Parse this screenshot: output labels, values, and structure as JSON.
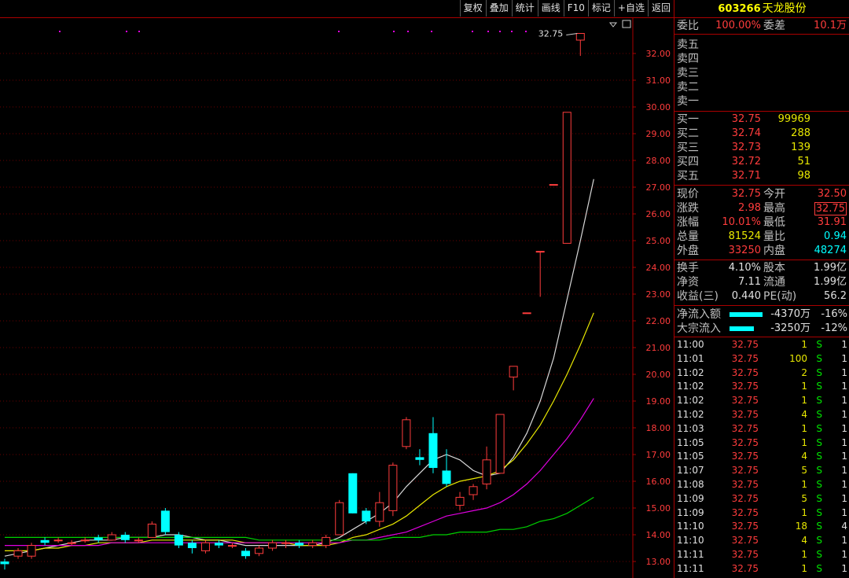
{
  "toolbar": {
    "buttons": [
      "复权",
      "叠加",
      "统计",
      "画线",
      "F10",
      "标记",
      "+自选",
      "返回"
    ]
  },
  "stock": {
    "code": "603266",
    "name": "天龙股份"
  },
  "ratio": {
    "label1": "委比",
    "value1": "100.00%",
    "label2": "委差",
    "value2": "10.1万"
  },
  "asks": [
    {
      "label": "卖五"
    },
    {
      "label": "卖四"
    },
    {
      "label": "卖三"
    },
    {
      "label": "卖二"
    },
    {
      "label": "卖一"
    }
  ],
  "bids": [
    {
      "label": "买一",
      "price": "32.75",
      "vol": "99969"
    },
    {
      "label": "买二",
      "price": "32.74",
      "vol": "288"
    },
    {
      "label": "买三",
      "price": "32.73",
      "vol": "139"
    },
    {
      "label": "买四",
      "price": "32.72",
      "vol": "51"
    },
    {
      "label": "买五",
      "price": "32.71",
      "vol": "98"
    }
  ],
  "quote": [
    {
      "l1": "现价",
      "v1": "32.75",
      "c1": "red",
      "l2": "今开",
      "v2": "32.50",
      "c2": "red"
    },
    {
      "l1": "涨跌",
      "v1": "2.98",
      "c1": "red",
      "l2": "最高",
      "v2": "32.75",
      "c2": "red"
    },
    {
      "l1": "涨幅",
      "v1": "10.01%",
      "c1": "red",
      "l2": "最低",
      "v2": "31.91",
      "c2": "red"
    },
    {
      "l1": "总量",
      "v1": "81524",
      "c1": "yel",
      "l2": "量比",
      "v2": "0.94",
      "c2": "cyan"
    },
    {
      "l1": "外盘",
      "v1": "33250",
      "c1": "red",
      "l2": "内盘",
      "v2": "48274",
      "c2": "cyan"
    }
  ],
  "fundamentals": [
    {
      "l1": "换手",
      "v1": "4.10%",
      "l2": "股本",
      "v2": "1.99亿"
    },
    {
      "l1": "净资",
      "v1": "7.11",
      "l2": "流通",
      "v2": "1.99亿"
    },
    {
      "l1": "收益(三)",
      "v1": "0.440",
      "l2": "PE(动)",
      "v2": "56.2"
    }
  ],
  "flows": [
    {
      "label": "净流入额",
      "value": "-4370万",
      "pct": "-16%",
      "bar": 0.75
    },
    {
      "label": "大宗流入",
      "value": "-3250万",
      "pct": "-12%",
      "bar": 0.56
    }
  ],
  "ticks": [
    {
      "t": "11:00",
      "p": "32.75",
      "v": "1",
      "s": "S",
      "n": "1"
    },
    {
      "t": "11:01",
      "p": "32.75",
      "v": "100",
      "s": "S",
      "n": "1"
    },
    {
      "t": "11:02",
      "p": "32.75",
      "v": "2",
      "s": "S",
      "n": "1"
    },
    {
      "t": "11:02",
      "p": "32.75",
      "v": "1",
      "s": "S",
      "n": "1"
    },
    {
      "t": "11:02",
      "p": "32.75",
      "v": "1",
      "s": "S",
      "n": "1"
    },
    {
      "t": "11:02",
      "p": "32.75",
      "v": "4",
      "s": "S",
      "n": "1"
    },
    {
      "t": "11:03",
      "p": "32.75",
      "v": "1",
      "s": "S",
      "n": "1"
    },
    {
      "t": "11:05",
      "p": "32.75",
      "v": "1",
      "s": "S",
      "n": "1"
    },
    {
      "t": "11:05",
      "p": "32.75",
      "v": "4",
      "s": "S",
      "n": "1"
    },
    {
      "t": "11:07",
      "p": "32.75",
      "v": "5",
      "s": "S",
      "n": "1"
    },
    {
      "t": "11:08",
      "p": "32.75",
      "v": "1",
      "s": "S",
      "n": "1"
    },
    {
      "t": "11:09",
      "p": "32.75",
      "v": "5",
      "s": "S",
      "n": "1"
    },
    {
      "t": "11:09",
      "p": "32.75",
      "v": "1",
      "s": "S",
      "n": "1"
    },
    {
      "t": "11:10",
      "p": "32.75",
      "v": "18",
      "s": "S",
      "n": "4"
    },
    {
      "t": "11:10",
      "p": "32.75",
      "v": "4",
      "s": "S",
      "n": "1"
    },
    {
      "t": "11:11",
      "p": "32.75",
      "v": "1",
      "s": "S",
      "n": "1"
    },
    {
      "t": "11:11",
      "p": "32.75",
      "v": "1",
      "s": "S",
      "n": "1"
    }
  ],
  "chart_data": {
    "type": "candlestick",
    "y_ticks": [
      "32.00",
      "31.00",
      "30.00",
      "29.00",
      "28.00",
      "27.00",
      "26.00",
      "25.00",
      "24.00",
      "23.00",
      "22.00",
      "21.00",
      "20.00",
      "19.00",
      "18.00",
      "17.00",
      "16.00",
      "15.00",
      "14.00",
      "13.00"
    ],
    "ylim": [
      12.7,
      33.0
    ],
    "high_label": "32.75",
    "candles": [
      {
        "o": 13.0,
        "c": 12.9,
        "h": 13.1,
        "l": 12.7
      },
      {
        "o": 13.2,
        "c": 13.4,
        "h": 13.5,
        "l": 13.1
      },
      {
        "o": 13.2,
        "c": 13.6,
        "h": 13.7,
        "l": 13.1
      },
      {
        "o": 13.8,
        "c": 13.7,
        "h": 13.9,
        "l": 13.6
      },
      {
        "o": 13.8,
        "c": 13.8,
        "h": 13.9,
        "l": 13.7
      },
      {
        "o": 13.7,
        "c": 13.7,
        "h": 13.8,
        "l": 13.6
      },
      {
        "o": 13.8,
        "c": 13.8,
        "h": 13.9,
        "l": 13.7
      },
      {
        "o": 13.9,
        "c": 13.8,
        "h": 14.0,
        "l": 13.7
      },
      {
        "o": 13.8,
        "c": 14.0,
        "h": 14.1,
        "l": 13.8
      },
      {
        "o": 14.0,
        "c": 13.8,
        "h": 14.1,
        "l": 13.7
      },
      {
        "o": 13.8,
        "c": 13.8,
        "h": 13.9,
        "l": 13.7
      },
      {
        "o": 13.9,
        "c": 14.4,
        "h": 14.5,
        "l": 13.9
      },
      {
        "o": 14.9,
        "c": 14.1,
        "h": 15.0,
        "l": 14.0
      },
      {
        "o": 14.0,
        "c": 13.6,
        "h": 14.1,
        "l": 13.5
      },
      {
        "o": 13.7,
        "c": 13.5,
        "h": 13.8,
        "l": 13.3
      },
      {
        "o": 13.4,
        "c": 13.7,
        "h": 13.8,
        "l": 13.3
      },
      {
        "o": 13.7,
        "c": 13.6,
        "h": 13.8,
        "l": 13.5
      },
      {
        "o": 13.6,
        "c": 13.6,
        "h": 13.7,
        "l": 13.5
      },
      {
        "o": 13.4,
        "c": 13.2,
        "h": 13.5,
        "l": 13.1
      },
      {
        "o": 13.3,
        "c": 13.5,
        "h": 13.6,
        "l": 13.2
      },
      {
        "o": 13.5,
        "c": 13.7,
        "h": 13.8,
        "l": 13.4
      },
      {
        "o": 13.7,
        "c": 13.7,
        "h": 13.8,
        "l": 13.5
      },
      {
        "o": 13.7,
        "c": 13.6,
        "h": 13.8,
        "l": 13.5
      },
      {
        "o": 13.6,
        "c": 13.7,
        "h": 13.8,
        "l": 13.5
      },
      {
        "o": 13.6,
        "c": 13.9,
        "h": 14.0,
        "l": 13.5
      },
      {
        "o": 14.0,
        "c": 15.2,
        "h": 15.3,
        "l": 14.0
      },
      {
        "o": 16.3,
        "c": 14.8,
        "h": 16.3,
        "l": 14.8
      },
      {
        "o": 14.9,
        "c": 14.5,
        "h": 15.0,
        "l": 14.4
      },
      {
        "o": 14.5,
        "c": 15.2,
        "h": 15.6,
        "l": 14.3
      },
      {
        "o": 14.9,
        "c": 16.6,
        "h": 16.7,
        "l": 14.7
      },
      {
        "o": 17.3,
        "c": 18.3,
        "h": 18.4,
        "l": 17.2
      },
      {
        "o": 16.9,
        "c": 16.8,
        "h": 17.2,
        "l": 16.6
      },
      {
        "o": 17.8,
        "c": 16.5,
        "h": 18.4,
        "l": 16.3
      },
      {
        "o": 16.4,
        "c": 15.9,
        "h": 17.2,
        "l": 15.8
      },
      {
        "o": 15.1,
        "c": 15.4,
        "h": 15.6,
        "l": 14.9
      },
      {
        "o": 15.5,
        "c": 15.8,
        "h": 15.9,
        "l": 15.3
      },
      {
        "o": 15.9,
        "c": 16.8,
        "h": 17.3,
        "l": 15.7
      },
      {
        "o": 16.3,
        "c": 18.5,
        "h": 18.5,
        "l": 16.3
      },
      {
        "o": 19.9,
        "c": 20.3,
        "h": 20.3,
        "l": 19.4
      },
      {
        "o": 22.3,
        "c": 22.3,
        "h": 22.3,
        "l": 22.3
      },
      {
        "o": 24.6,
        "c": 24.6,
        "h": 24.6,
        "l": 22.9
      },
      {
        "o": 27.1,
        "c": 27.1,
        "h": 27.1,
        "l": 27.1
      },
      {
        "o": 24.9,
        "c": 29.8,
        "h": 29.8,
        "l": 24.9
      },
      {
        "o": 32.5,
        "c": 32.75,
        "h": 32.75,
        "l": 31.91
      }
    ],
    "ma_lines": [
      {
        "color": "#d8d8d8",
        "values": [
          13.2,
          13.3,
          13.4,
          13.5,
          13.6,
          13.7,
          13.8,
          13.8,
          13.8,
          13.9,
          13.9,
          13.9,
          14.0,
          14.0,
          13.9,
          13.8,
          13.8,
          13.7,
          13.6,
          13.6,
          13.6,
          13.6,
          13.6,
          13.6,
          13.7,
          13.9,
          14.2,
          14.5,
          14.8,
          15.2,
          15.8,
          16.3,
          16.8,
          17.0,
          16.8,
          16.4,
          16.2,
          16.3,
          16.9,
          17.8,
          19.0,
          20.6,
          22.8,
          25.0,
          27.3
        ]
      },
      {
        "color": "#e8e800",
        "values": [
          13.4,
          13.4,
          13.4,
          13.5,
          13.5,
          13.6,
          13.6,
          13.7,
          13.7,
          13.7,
          13.7,
          13.8,
          13.8,
          13.8,
          13.8,
          13.8,
          13.8,
          13.8,
          13.7,
          13.7,
          13.7,
          13.7,
          13.6,
          13.6,
          13.6,
          13.7,
          13.9,
          14.0,
          14.2,
          14.4,
          14.7,
          15.1,
          15.5,
          15.8,
          16.0,
          16.1,
          16.2,
          16.4,
          16.8,
          17.4,
          18.1,
          19.0,
          20.0,
          21.1,
          22.3
        ]
      },
      {
        "color": "#e000e0",
        "values": [
          13.6,
          13.6,
          13.6,
          13.6,
          13.6,
          13.6,
          13.6,
          13.6,
          13.7,
          13.7,
          13.7,
          13.7,
          13.7,
          13.7,
          13.7,
          13.7,
          13.7,
          13.7,
          13.7,
          13.7,
          13.7,
          13.7,
          13.7,
          13.7,
          13.7,
          13.7,
          13.8,
          13.8,
          13.9,
          14.0,
          14.1,
          14.3,
          14.5,
          14.7,
          14.8,
          14.9,
          15.0,
          15.2,
          15.5,
          15.9,
          16.4,
          17.0,
          17.6,
          18.3,
          19.1
        ]
      },
      {
        "color": "#00d000",
        "values": [
          13.9,
          13.9,
          13.9,
          13.9,
          13.9,
          13.9,
          13.9,
          13.9,
          13.9,
          13.9,
          13.9,
          13.9,
          13.9,
          13.9,
          13.9,
          13.9,
          13.9,
          13.9,
          13.9,
          13.8,
          13.8,
          13.8,
          13.8,
          13.8,
          13.8,
          13.8,
          13.8,
          13.8,
          13.8,
          13.9,
          13.9,
          13.9,
          14.0,
          14.0,
          14.1,
          14.1,
          14.1,
          14.2,
          14.2,
          14.3,
          14.5,
          14.6,
          14.8,
          15.1,
          15.4
        ]
      }
    ]
  }
}
